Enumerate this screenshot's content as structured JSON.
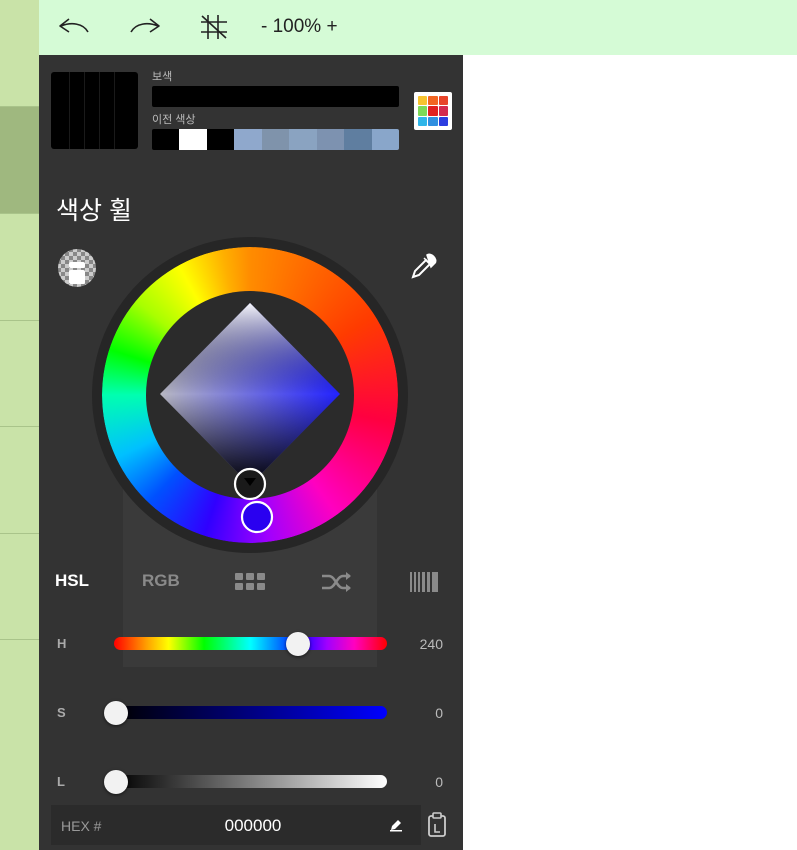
{
  "toolbar": {
    "undo_icon": "undo-icon",
    "redo_icon": "redo-icon",
    "grid_icon": "no-grid-icon",
    "zoom_minus": "-",
    "zoom_value": "100%",
    "zoom_plus": "+"
  },
  "colors": {
    "left_strip": "#c9e3a8",
    "topbar": "#d5fbd6",
    "panel": "#333333"
  },
  "color_panel": {
    "current_color": "#000000",
    "complementary_label": "보색",
    "complementary_color": "#000000",
    "history_label": "이전 색상",
    "history": [
      "#000000",
      "#ffffff",
      "#000000",
      "#8fa8cc",
      "#7f93ab",
      "#8aa3c1",
      "#7d92b0",
      "#5f7ea0",
      "#89a6ca"
    ],
    "palette_colors": [
      "#f7c42e",
      "#f26522",
      "#e8442a",
      "#7ed957",
      "#e02020",
      "#d42a4f",
      "#2fb6e9",
      "#2f8fe0",
      "#2c3de0"
    ],
    "section_title": "색상 휠",
    "tabs": [
      "HSL",
      "RGB"
    ],
    "active_tab": "HSL",
    "sliders": [
      {
        "label": "H",
        "value": "240",
        "fraction": 0.667
      },
      {
        "label": "S",
        "value": "0",
        "fraction": 0.0
      },
      {
        "label": "L",
        "value": "0",
        "fraction": 0.0
      }
    ],
    "hex_label": "HEX #",
    "hex_value": "000000"
  }
}
